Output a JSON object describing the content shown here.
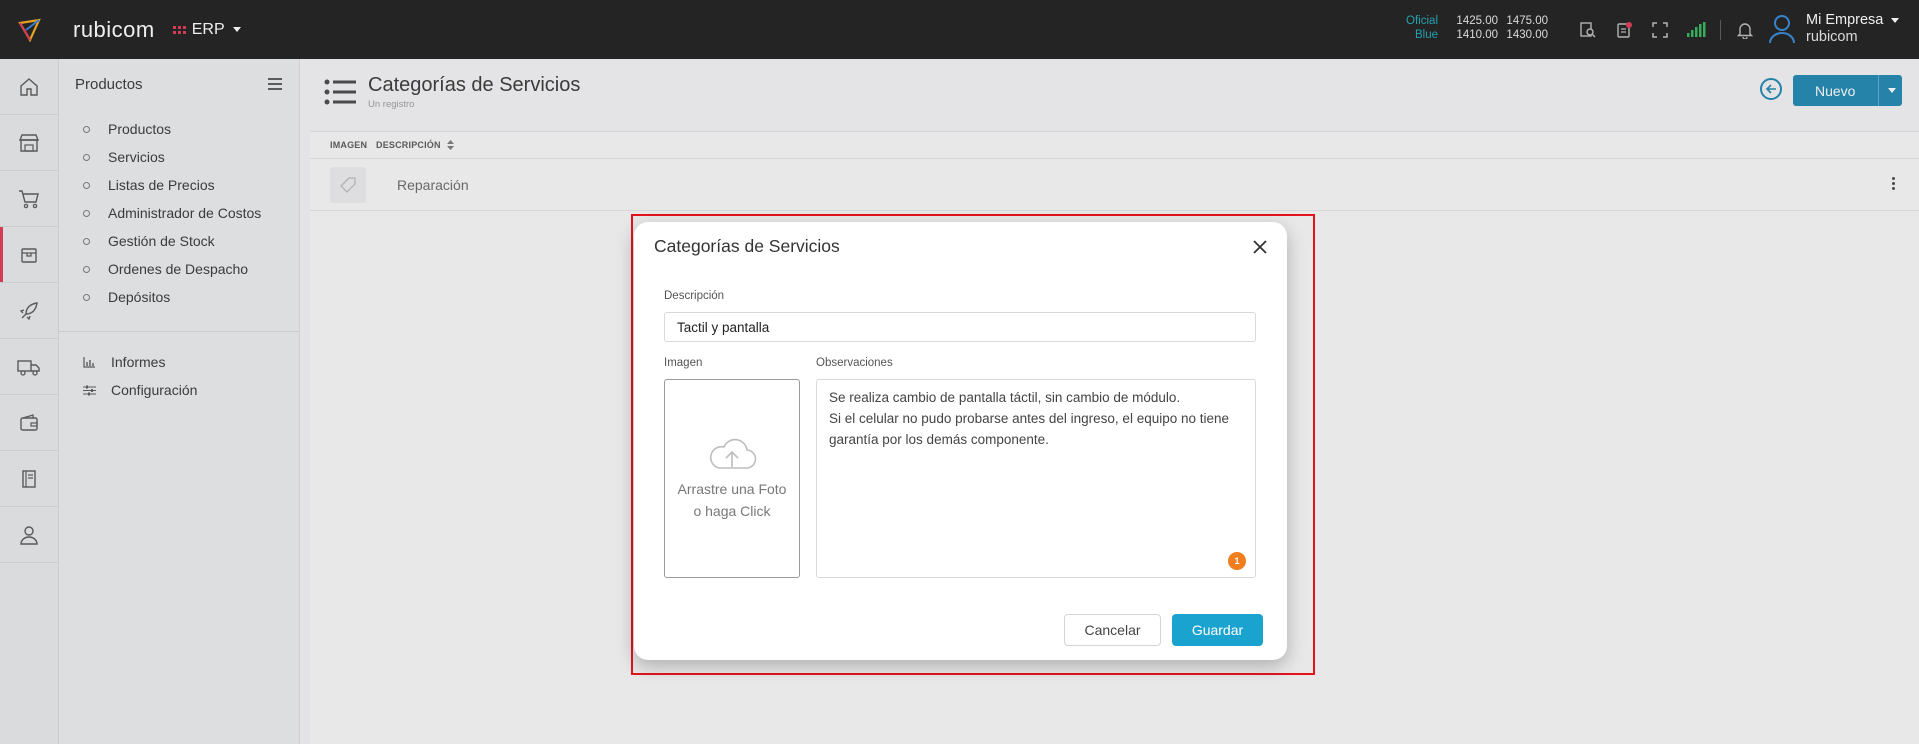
{
  "header": {
    "brand": "rubicom",
    "module": "ERP",
    "rates": [
      {
        "label": "Oficial",
        "buy": "1425.00",
        "sell": "1475.00"
      },
      {
        "label": "Blue",
        "buy": "1410.00",
        "sell": "1430.00"
      }
    ],
    "user_name": "Mi Empresa",
    "user_company": "rubicom"
  },
  "rail": [
    "home-icon",
    "store-icon",
    "cart-icon",
    "box-icon",
    "rocket-icon",
    "truck-icon",
    "wallet-icon",
    "book-icon",
    "user-icon"
  ],
  "sidenav": {
    "title": "Productos",
    "items": [
      "Productos",
      "Servicios",
      "Listas de Precios",
      "Administrador de Costos",
      "Gestión de Stock",
      "Ordenes de Despacho",
      "Depósitos"
    ],
    "tools": [
      "Informes",
      "Configuración"
    ]
  },
  "page": {
    "title": "Categorías de Servicios",
    "subtitle": "Un registro",
    "new_label": "Nuevo"
  },
  "table": {
    "columns": [
      "IMAGEN",
      "DESCRIPCIÓN"
    ],
    "rows": [
      {
        "description": "Reparación"
      }
    ]
  },
  "modal": {
    "title": "Categorías de Servicios",
    "description_label": "Descripción",
    "description_value": "Tactil y pantalla",
    "image_label": "Imagen",
    "upload_line1": "Arrastre una Foto",
    "upload_line2": "o haga Click",
    "notes_label": "Observaciones",
    "notes_value": "Se realiza cambio de pantalla táctil, sin cambio de módulo.\nSi el celular no pudo probarse antes del ingreso, el equipo no tiene garantía por los demás componente.",
    "badge": "1",
    "cancel_label": "Cancelar",
    "save_label": "Guardar"
  },
  "colors": {
    "accent": "#1a83b0",
    "save": "#1aa3cf",
    "highlight": "#e3131c",
    "badge": "#f07e1e"
  }
}
